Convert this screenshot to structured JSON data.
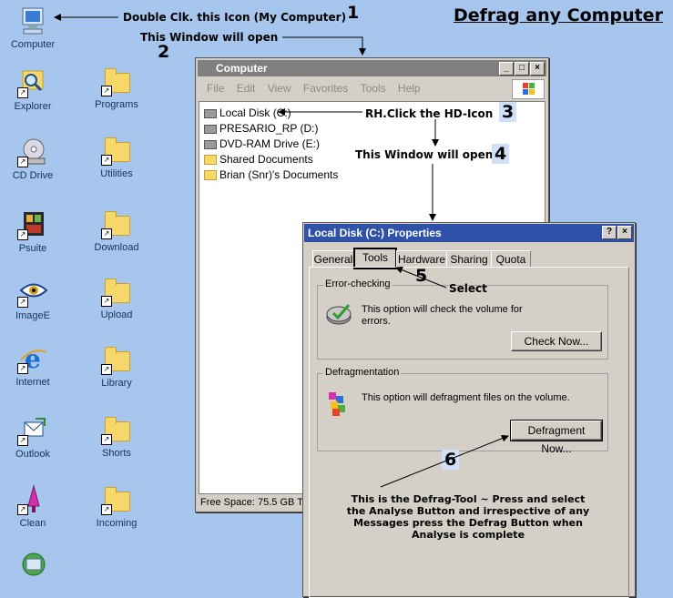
{
  "page_title": "Defrag any Computer",
  "desktop_icons": [
    {
      "label": "Computer",
      "icon": "computer-icon"
    },
    {
      "label": "Explorer",
      "icon": "explorer-icon"
    },
    {
      "label": "Programs",
      "icon": "folder-icon"
    },
    {
      "label": "CD Drive",
      "icon": "cd-icon"
    },
    {
      "label": "Utilities",
      "icon": "folder-icon"
    },
    {
      "label": "Psuite",
      "icon": "psuite-icon"
    },
    {
      "label": "Download",
      "icon": "folder-icon"
    },
    {
      "label": "ImageE",
      "icon": "eye-icon"
    },
    {
      "label": "Upload",
      "icon": "folder-icon"
    },
    {
      "label": "Internet",
      "icon": "ie-icon"
    },
    {
      "label": "Library",
      "icon": "folder-icon"
    },
    {
      "label": "Outlook",
      "icon": "outlook-icon"
    },
    {
      "label": "Shorts",
      "icon": "folder-icon"
    },
    {
      "label": "Clean",
      "icon": "funnel-icon"
    },
    {
      "label": "Incoming",
      "icon": "folder-icon"
    }
  ],
  "annotations": {
    "step1_text": "Double Clk. this Icon (My Computer)",
    "step1_num": "1",
    "step2_text": "This Window will open",
    "step2_num": "2",
    "step3_text": "RH.Click the HD-Icon",
    "step3_num": "3",
    "step4_text": "This Window will open",
    "step4_num": "4",
    "step5_text": "Select",
    "step5_num": "5",
    "step6_num": "6",
    "step6_text_lines": [
      "This is the Defrag-Tool ~ Press and select",
      "the Analyse Button and irrespective of any",
      "Messages press the Defrag Button when",
      "Analyse is complete"
    ]
  },
  "computer_window": {
    "title": "Computer",
    "menu": [
      "File",
      "Edit",
      "View",
      "Favorites",
      "Tools",
      "Help"
    ],
    "items": [
      {
        "label": "Local Disk (C:)",
        "type": "drive"
      },
      {
        "label": "PRESARIO_RP (D:)",
        "type": "drive"
      },
      {
        "label": "DVD-RAM Drive (E:)",
        "type": "drive"
      },
      {
        "label": "Shared Documents",
        "type": "folder"
      },
      {
        "label": "Brian (Snr)'s Documents",
        "type": "folder"
      }
    ],
    "status": "Free Space: 75.5 GB  To"
  },
  "properties_dialog": {
    "title": "Local Disk (C:) Properties",
    "tabs": [
      "General",
      "Tools",
      "Hardware",
      "Sharing",
      "Quota"
    ],
    "active_tab": "Tools",
    "error_group": {
      "label": "Error-checking",
      "text_lines": [
        "This option will check the volume for",
        "errors."
      ],
      "button": "Check Now..."
    },
    "defrag_group": {
      "label": "Defragmentation",
      "text": "This option will defragment files on the volume.",
      "button": "Defragment Now..."
    }
  }
}
